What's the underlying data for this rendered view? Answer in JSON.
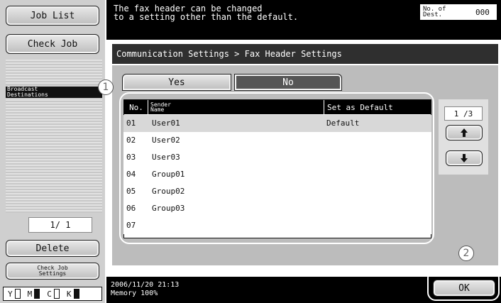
{
  "left": {
    "job_list": "Job List",
    "check_job": "Check Job",
    "broadcast_label": "Broadcast\nDestinations",
    "page": "1/  1",
    "delete": "Delete",
    "check_job_settings": "Check Job\nSettings"
  },
  "header": {
    "message": "The fax header can be changed\nto a setting other than the default.",
    "dest_label": "No. of\nDest.",
    "dest_count": "000"
  },
  "breadcrumb": "Communication Settings > Fax Header Settings",
  "tabs": {
    "yes": "Yes",
    "no": "No"
  },
  "table": {
    "headers": {
      "no": "No.",
      "name": "Sender\nName",
      "default": "Set as Default"
    },
    "rows": [
      {
        "no": "01",
        "name": "User01",
        "default": "Default"
      },
      {
        "no": "02",
        "name": "User02",
        "default": ""
      },
      {
        "no": "03",
        "name": "User03",
        "default": ""
      },
      {
        "no": "04",
        "name": "Group01",
        "default": ""
      },
      {
        "no": "05",
        "name": "Group02",
        "default": ""
      },
      {
        "no": "06",
        "name": "Group03",
        "default": ""
      },
      {
        "no": "07",
        "name": "",
        "default": ""
      }
    ]
  },
  "pager": {
    "indicator": "1 /3"
  },
  "callouts": {
    "one": "1",
    "two": "2"
  },
  "footer": {
    "datetime": "2006/11/20   21:13\nMemory       100%",
    "ok": "OK"
  },
  "toner": [
    {
      "label": "Y",
      "level": 0.05
    },
    {
      "label": "M",
      "level": 1.0
    },
    {
      "label": "C",
      "level": 0.05
    },
    {
      "label": "K",
      "level": 1.0
    }
  ],
  "icons": {
    "up": "arrow-up-icon",
    "down": "arrow-down-icon"
  }
}
